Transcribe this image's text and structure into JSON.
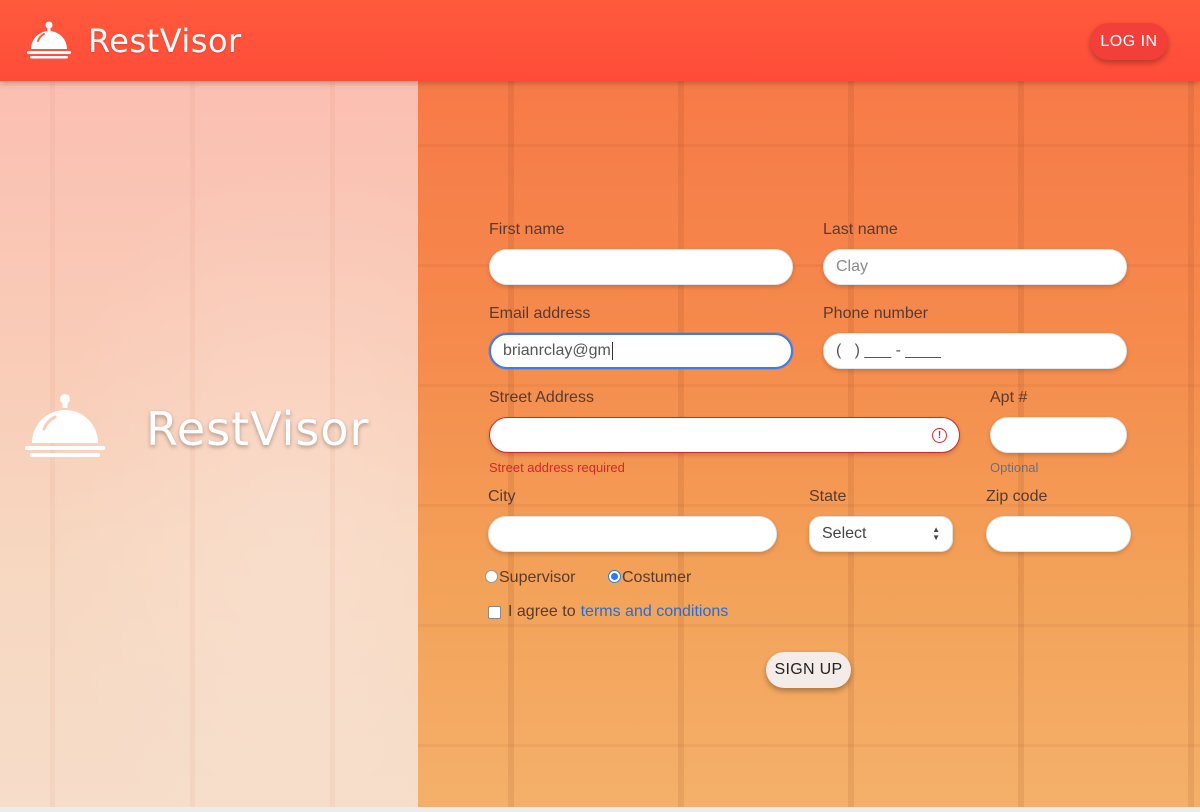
{
  "header": {
    "brand_title": "RestVisor",
    "login_label": "LOG IN",
    "icon": "cloche-icon",
    "background_color": "#ff4c3a"
  },
  "left_panel": {
    "brand_title": "RestVisor",
    "icon": "cloche-icon"
  },
  "form": {
    "first_name": {
      "label": "First name",
      "value": ""
    },
    "last_name": {
      "label": "Last name",
      "value": "",
      "placeholder": "Clay"
    },
    "email": {
      "label": "Email address",
      "value": "brianrclay@gm"
    },
    "phone": {
      "label": "Phone number",
      "value": "(   ) ___ - ____"
    },
    "street": {
      "label": "Street Address",
      "value": "",
      "error": "Street address required"
    },
    "apt": {
      "label": "Apt #",
      "value": "",
      "hint": "Optional"
    },
    "city": {
      "label": "City",
      "value": ""
    },
    "state": {
      "label": "State",
      "selected": "Select"
    },
    "zip": {
      "label": "Zip code",
      "value": ""
    },
    "role": {
      "options": [
        {
          "label": "Supervisor",
          "checked": false
        },
        {
          "label": "Costumer",
          "checked": true
        }
      ]
    },
    "agree": {
      "prefix": "I agree to",
      "link": "terms and conditions",
      "checked": false
    },
    "submit_label": "SIGN UP"
  },
  "colors": {
    "accent": "#ff4c3a",
    "error": "#d8262c",
    "focus": "#3d7be8",
    "link": "#1f6fd6"
  }
}
